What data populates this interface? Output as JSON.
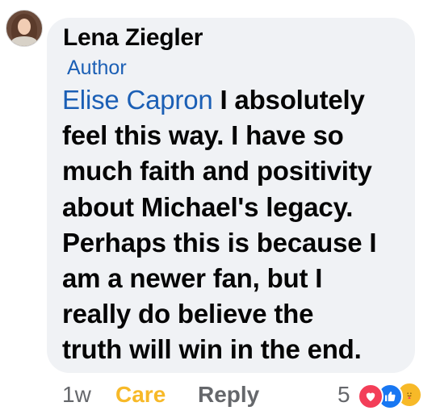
{
  "comment": {
    "author_name": "Lena Ziegler",
    "author_badge": "Author",
    "mention": "Elise Capron",
    "text_lines": [
      " I absolutely",
      "feel this way. I have so",
      "much faith and positivity",
      "about Michael's legacy.",
      "Perhaps this is because I",
      "am a newer fan, but I",
      "really do believe the",
      "truth will win in the end."
    ]
  },
  "actions": {
    "time": "1w",
    "care_label": "Care",
    "reply_label": "Reply",
    "reaction_count": "5",
    "reactions": [
      "love-icon",
      "like-icon",
      "care-icon"
    ]
  },
  "colors": {
    "bubble_bg": "#f0f2f5",
    "mention": "#1b5fb5",
    "care": "#f7b928",
    "meta_gray": "#65676b",
    "love": "#f33e58",
    "like": "#1877f2"
  }
}
